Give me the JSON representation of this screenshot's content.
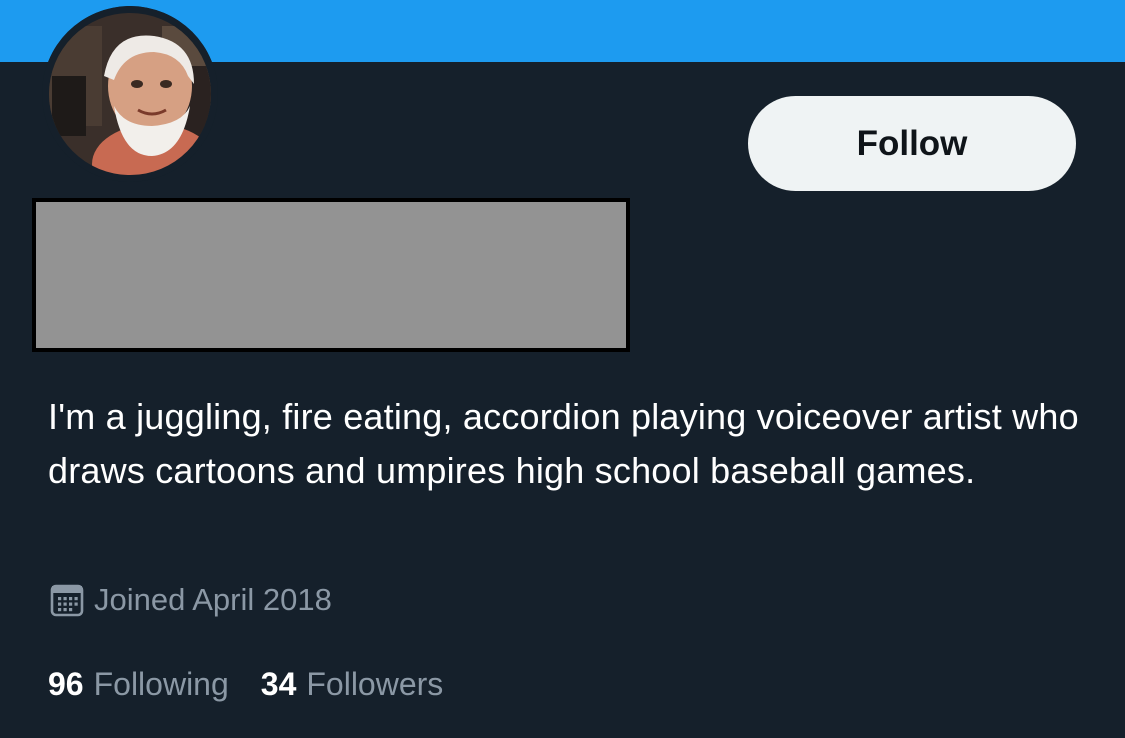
{
  "profile": {
    "follow_label": "Follow",
    "bio": "I'm a juggling, fire eating, accordion playing voiceover artist who draws cartoons and umpires high school baseball games.",
    "joined_text": "Joined April 2018",
    "stats": {
      "following_count": "96",
      "following_label": "Following",
      "followers_count": "34",
      "followers_label": "Followers"
    }
  },
  "icons": {
    "joined": "calendar-icon"
  },
  "colors": {
    "background": "#15202b",
    "banner": "#1d9bf0",
    "follow_button_bg": "#eff3f4",
    "secondary_text": "#8b98a5",
    "redaction": "#939393"
  }
}
